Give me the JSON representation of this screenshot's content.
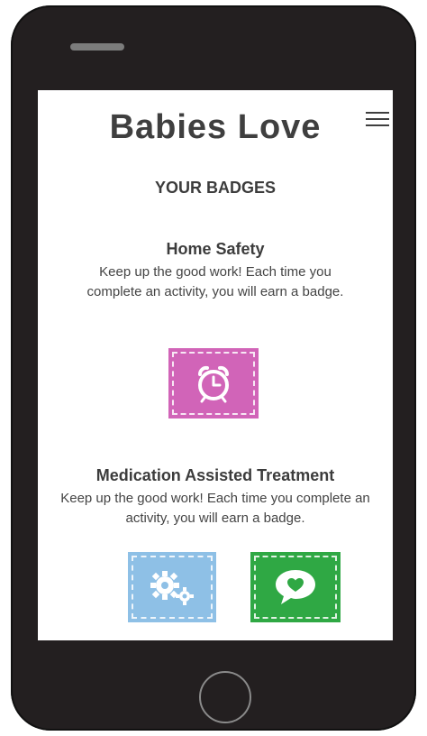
{
  "app": {
    "title": "Babies Love"
  },
  "page": {
    "section_title": "YOUR BADGES"
  },
  "badge_groups": [
    {
      "title": "Home Safety",
      "description": "Keep up the good work! Each time you complete an activity, you will earn a badge.",
      "badges": [
        {
          "icon": "alarm-clock-icon",
          "color": "#d164b8"
        }
      ]
    },
    {
      "title": "Medication Assisted Treatment",
      "description": "Keep up the good work! Each time you complete an activity, you will earn a badge.",
      "badges": [
        {
          "icon": "gears-icon",
          "color": "#8ec0e6"
        },
        {
          "icon": "heart-speech-bubble-icon",
          "color": "#2fa844"
        }
      ]
    }
  ],
  "colors": {
    "phone_body": "#231f20",
    "title_text": "#3f3f3f"
  }
}
